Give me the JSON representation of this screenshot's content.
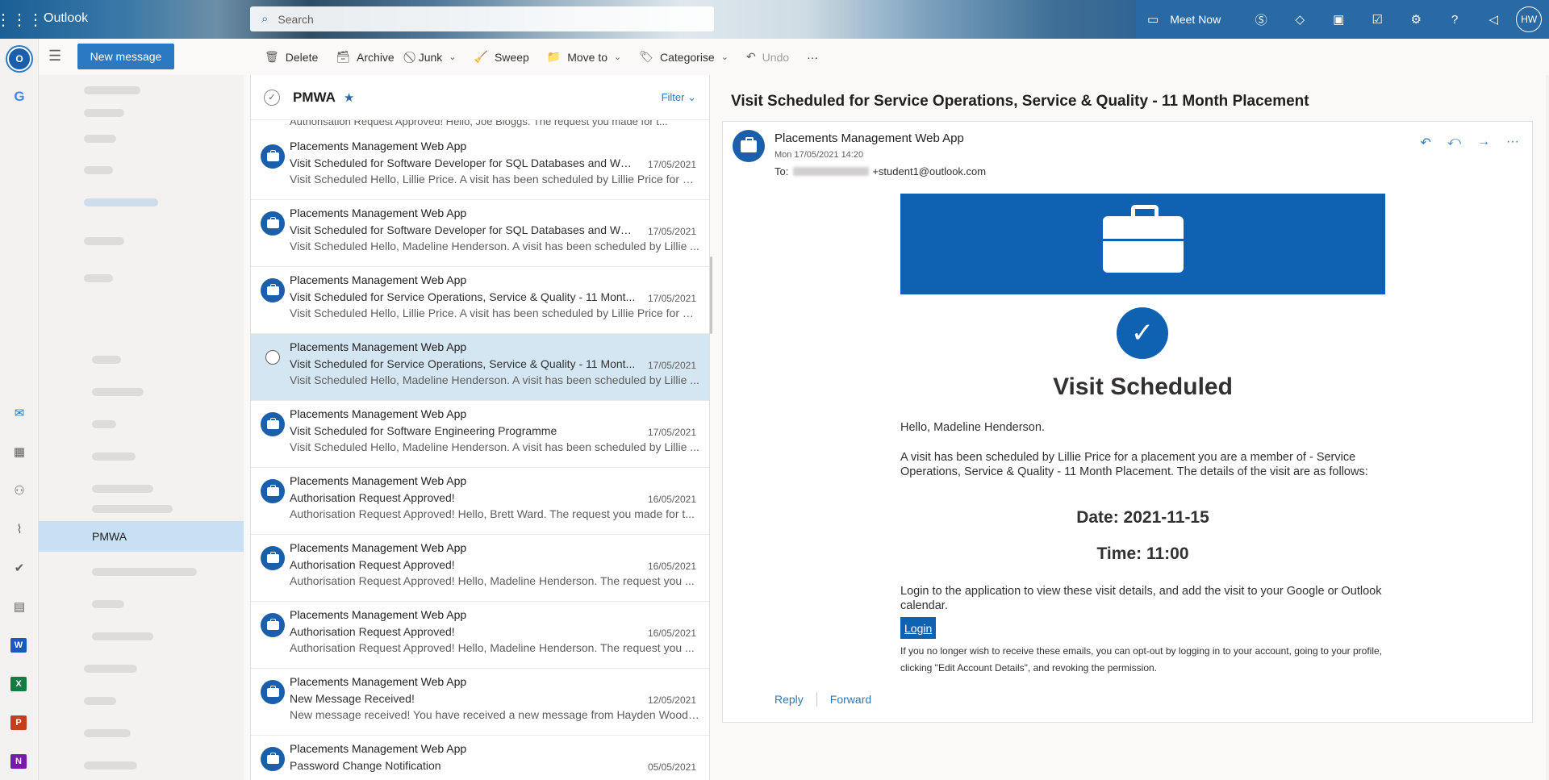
{
  "topbar": {
    "app_name": "Outlook",
    "search_placeholder": "Search",
    "meet_now": "Meet Now",
    "avatar_initials": "HW"
  },
  "commandbar": {
    "new_message": "New message",
    "commands": [
      {
        "label": "Delete",
        "icon": "trash-icon",
        "glyph": "🗑",
        "dropdown": false,
        "disabled": false
      },
      {
        "label": "Archive",
        "icon": "archive-icon",
        "glyph": "🗃",
        "dropdown": false,
        "disabled": false
      },
      {
        "label": "Junk",
        "icon": "junk-icon",
        "glyph": "⃠",
        "dropdown": true,
        "disabled": false
      },
      {
        "label": "Sweep",
        "icon": "sweep-icon",
        "glyph": "🧹",
        "dropdown": false,
        "disabled": false
      },
      {
        "label": "Move to",
        "icon": "move-to-icon",
        "glyph": "📁",
        "dropdown": true,
        "disabled": false
      },
      {
        "label": "Categorise",
        "icon": "tag-icon",
        "glyph": "🏷",
        "dropdown": true,
        "disabled": false
      },
      {
        "label": "Undo",
        "icon": "undo-icon",
        "glyph": "↶",
        "dropdown": false,
        "disabled": true
      }
    ],
    "more": "···"
  },
  "folders": {
    "selected": "PMWA"
  },
  "list": {
    "folder_name": "PMWA",
    "filter_label": "Filter",
    "partial_preview": "Authorisation Request Approved! Hello, Joe Bloggs. The request you made for t...",
    "items": [
      {
        "sender": "Placements Management Web App",
        "subject": "Visit Scheduled for Software Developer for SQL Databases and Web...",
        "date": "17/05/2021",
        "preview": "Visit Scheduled Hello, Lillie Price. A visit has been scheduled by Lillie Price for a ...",
        "selected": false
      },
      {
        "sender": "Placements Management Web App",
        "subject": "Visit Scheduled for Software Developer for SQL Databases and Web...",
        "date": "17/05/2021",
        "preview": "Visit Scheduled Hello, Madeline Henderson. A visit has been scheduled by Lillie ...",
        "selected": false
      },
      {
        "sender": "Placements Management Web App",
        "subject": "Visit Scheduled for Service Operations, Service & Quality - 11 Mont...",
        "date": "17/05/2021",
        "preview": "Visit Scheduled Hello, Lillie Price. A visit has been scheduled by Lillie Price for a ...",
        "selected": false
      },
      {
        "sender": "Placements Management Web App",
        "subject": "Visit Scheduled for Service Operations, Service & Quality - 11 Mont...",
        "date": "17/05/2021",
        "preview": "Visit Scheduled Hello, Madeline Henderson. A visit has been scheduled by Lillie ...",
        "selected": true
      },
      {
        "sender": "Placements Management Web App",
        "subject": "Visit Scheduled for Software Engineering Programme",
        "date": "17/05/2021",
        "preview": "Visit Scheduled Hello, Madeline Henderson. A visit has been scheduled by Lillie ...",
        "selected": false
      },
      {
        "sender": "Placements Management Web App",
        "subject": "Authorisation Request Approved!",
        "date": "16/05/2021",
        "preview": "Authorisation Request Approved! Hello, Brett Ward. The request you made for t...",
        "selected": false
      },
      {
        "sender": "Placements Management Web App",
        "subject": "Authorisation Request Approved!",
        "date": "16/05/2021",
        "preview": "Authorisation Request Approved! Hello, Madeline Henderson. The request you ...",
        "selected": false
      },
      {
        "sender": "Placements Management Web App",
        "subject": "Authorisation Request Approved!",
        "date": "16/05/2021",
        "preview": "Authorisation Request Approved! Hello, Madeline Henderson. The request you ...",
        "selected": false
      },
      {
        "sender": "Placements Management Web App",
        "subject": "New Message Received!",
        "date": "12/05/2021",
        "preview": "New message received! You have received a new message from Hayden Woods:...",
        "selected": false
      },
      {
        "sender": "Placements Management Web App",
        "subject": "Password Change Notification",
        "date": "05/05/2021",
        "preview": "",
        "selected": false
      }
    ]
  },
  "reading": {
    "subject": "Visit Scheduled for Service Operations, Service & Quality - 11 Month Placement",
    "sender": "Placements Management Web App",
    "date": "Mon 17/05/2021 14:20",
    "to_label": "To:",
    "to_address": "+student1@outlook.com",
    "heading": "Visit Scheduled",
    "greeting": "Hello, Madeline Henderson.",
    "paragraph": "A visit has been scheduled by Lillie Price for a placement you are a member of - Service Operations, Service & Quality - 11 Month Placement. The details of the visit are as follows:",
    "date_line": "Date: 2021-11-15",
    "time_line": "Time: 11:00",
    "login_paragraph": "Login to the application to view these visit details, and add the visit to your Google or Outlook calendar.",
    "login_button": "Login",
    "optout": "If you no longer wish to receive these emails, you can opt-out by logging in to your account, going to your profile, clicking \"Edit Account Details\", and revoking the permission.",
    "reply": "Reply",
    "forward": "Forward"
  },
  "colors": {
    "accent": "#2a79c2",
    "brand_blue": "#0f62b1",
    "selected_row": "#d5e6f3"
  }
}
